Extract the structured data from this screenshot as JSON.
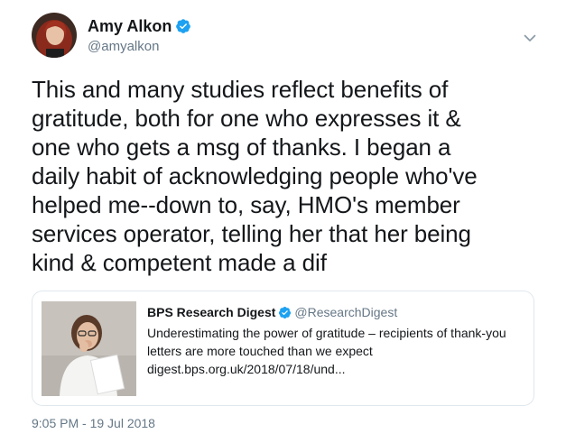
{
  "author": {
    "display_name": "Amy Alkon",
    "handle": "@amyalkon"
  },
  "tweet": {
    "text": "This and many studies reflect benefits of\ngratitude, both for one who expresses it &\none who gets a msg of thanks. I began a\ndaily habit of acknowledging people who've\nhelped me--down to, say, HMO's member\nservices operator, telling her that her being\nkind & competent made a dif",
    "timestamp": "9:05 PM - 19 Jul 2018"
  },
  "quoted": {
    "display_name": "BPS Research Digest",
    "handle": "@ResearchDigest",
    "text_line1": "Underestimating the power of gratitude – recipients of thank-you",
    "text_line2": "letters are more touched than we expect",
    "link": "digest.bps.org.uk/2018/07/18/und..."
  },
  "icons": {
    "verified": "verified-badge-icon",
    "caret": "chevron-down-icon"
  },
  "colors": {
    "verified": "#1da1f2",
    "secondary_text": "#657786",
    "border": "#e1e8ed"
  }
}
